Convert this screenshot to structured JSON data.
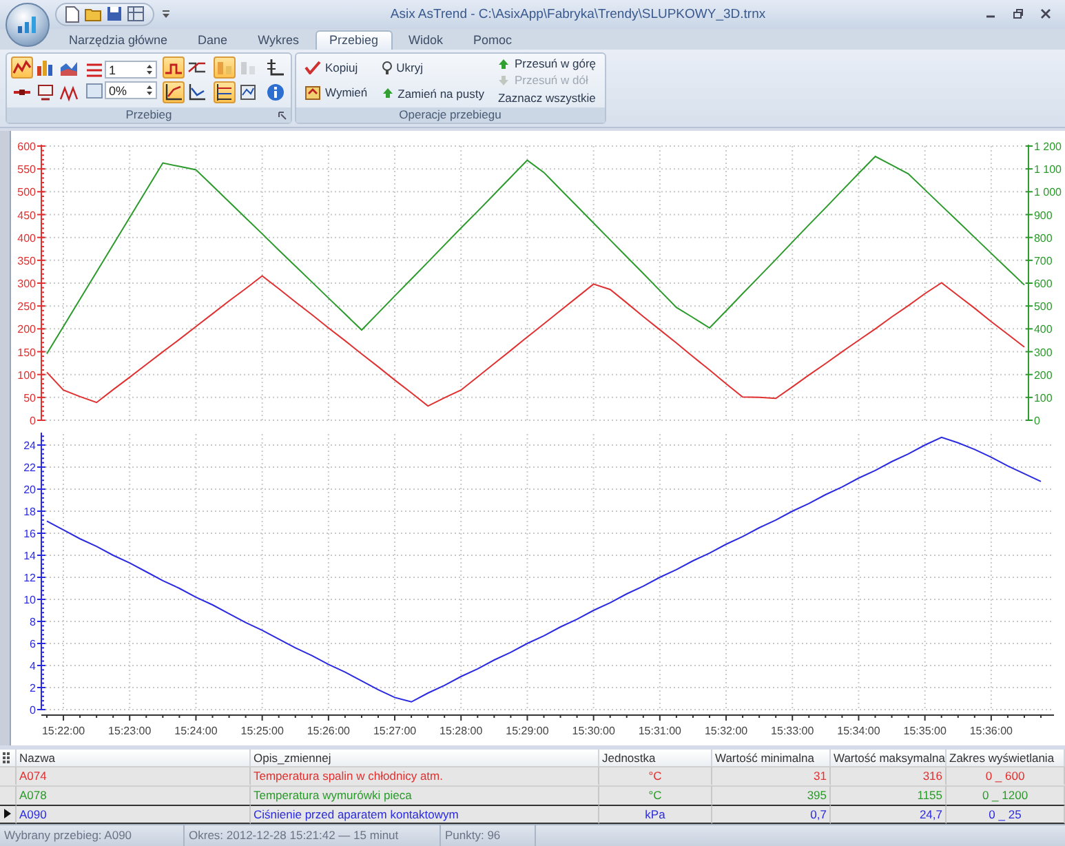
{
  "window": {
    "title": "Asix AsTrend - C:\\AsixApp\\Fabryka\\Trendy\\SLUPKOWY_3D.trnx"
  },
  "tabs": [
    {
      "label": "Narzędzia główne",
      "selected": false
    },
    {
      "label": "Dane",
      "selected": false
    },
    {
      "label": "Wykres",
      "selected": false
    },
    {
      "label": "Przebieg",
      "selected": true
    },
    {
      "label": "Widok",
      "selected": false
    },
    {
      "label": "Pomoc",
      "selected": false
    }
  ],
  "ribbon": {
    "series_group": {
      "label": "Przebieg",
      "tools": [
        {
          "selected": true,
          "disabled": false
        },
        {
          "selected": false,
          "disabled": false
        },
        {
          "selected": false,
          "disabled": false
        },
        {
          "selected": false,
          "disabled": false
        },
        {
          "selected": false,
          "disabled": false
        },
        {
          "selected": false,
          "disabled": false
        },
        {
          "selected": true,
          "disabled": false
        },
        {
          "selected": false,
          "disabled": false
        },
        {
          "selected": true,
          "disabled": false
        },
        {
          "selected": false,
          "disabled": false
        },
        {
          "selected": true,
          "disabled": false
        },
        {
          "selected": false,
          "disabled": true
        },
        {
          "selected": true,
          "disabled": false
        },
        {
          "selected": false,
          "disabled": false
        },
        {
          "selected": false,
          "disabled": false
        },
        {
          "selected": false,
          "disabled": false
        }
      ],
      "spinners": [
        {
          "value": "1"
        },
        {
          "value": "0%"
        }
      ]
    },
    "operations_group": {
      "label": "Operacje przebiegu",
      "columns": [
        {
          "actions": [
            {
              "label": "Kopiuj",
              "disabled": false
            },
            {
              "label": "Wymień",
              "disabled": false
            }
          ]
        },
        {
          "actions": [
            {
              "label": "Ukryj",
              "disabled": false
            },
            {
              "label": "Zamień na pusty",
              "disabled": false
            }
          ]
        },
        {
          "actions": [
            {
              "label": "Przesuń w górę",
              "disabled": false
            },
            {
              "label": "Przesuń w dół",
              "disabled": true
            },
            {
              "label": "Zaznacz wszystkie",
              "disabled": false
            }
          ]
        }
      ]
    }
  },
  "charts": [
    {
      "chart_data": {
        "type": "line",
        "categories": [
          null,
          null,
          null,
          null,
          null,
          null,
          null,
          null,
          null,
          null,
          null,
          null,
          null,
          null,
          null,
          null,
          null,
          null,
          null,
          null,
          null,
          null,
          null,
          null,
          null,
          null,
          null,
          null,
          null,
          null,
          null,
          null,
          null,
          null,
          null,
          null,
          null,
          null,
          null,
          null,
          null,
          null,
          null,
          null,
          null,
          null,
          null,
          null,
          null,
          null,
          null,
          null,
          null,
          null,
          null,
          null,
          null,
          null,
          null,
          null
        ],
        "grid": true,
        "ylim": [
          0,
          600
        ],
        "yticks": [
          0,
          50,
          100,
          150,
          200,
          250,
          300,
          350,
          400,
          450,
          500,
          550,
          600
        ],
        "y2lim": [
          0,
          1200
        ],
        "y2ticks": [
          0,
          100,
          200,
          300,
          400,
          500,
          600,
          700,
          800,
          900,
          {
            "value": 1000,
            "label": "1 000"
          },
          {
            "value": 1100,
            "label": "1 100"
          },
          {
            "value": 1200,
            "label": "1 200"
          }
        ],
        "series": [
          {
            "color": "#e03030",
            "values": [
              105,
              66,
              52,
              39,
              67,
              94,
              122,
              150,
              177,
              205,
              233,
              261,
              288,
              316,
              288,
              259,
              231,
              202,
              174,
              145,
              117,
              88,
              60,
              31,
              49,
              66,
              95,
              124,
              153,
              182,
              211,
              240,
              269,
              298,
              286,
              257,
              227,
              198,
              169,
              139,
              110,
              80,
              51,
              50,
              48,
              73,
              99,
              124,
              150,
              175,
              200,
              226,
              251,
              277,
              301,
              273,
              245,
              216,
              188,
              160
            ]
          },
          {
            "color": "#2a9a2a",
            "axis": "y2",
            "values": [
              291,
              410,
              529,
              649,
              768,
              887,
              1007,
              1126,
              1111,
              1096,
              1026,
              956,
              886,
              816,
              745,
              675,
              605,
              535,
              465,
              395,
              469,
              544,
              618,
              692,
              767,
              841,
              915,
              989,
              1064,
              1138,
              1084,
              1010,
              937,
              863,
              789,
              715,
              642,
              568,
              494,
              449,
              404,
              479,
              554,
              629,
              704,
              780,
              855,
              930,
              1005,
              1080,
              1155,
              1117,
              1078,
              1009,
              939,
              870,
              800,
              731,
              661,
              592
            ]
          }
        ]
      }
    },
    {
      "chart_data": {
        "type": "line",
        "categories": [
          null,
          "15:22:00",
          null,
          null,
          null,
          "15:23:00",
          null,
          null,
          null,
          "15:24:00",
          null,
          null,
          null,
          "15:25:00",
          null,
          null,
          null,
          "15:26:00",
          null,
          null,
          null,
          "15:27:00",
          null,
          null,
          null,
          "15:28:00",
          null,
          null,
          null,
          "15:29:00",
          null,
          null,
          null,
          "15:30:00",
          null,
          null,
          null,
          "15:31:00",
          null,
          null,
          null,
          "15:32:00",
          null,
          null,
          null,
          "15:33:00",
          null,
          null,
          null,
          "15:34:00",
          null,
          null,
          null,
          "15:35:00",
          null,
          null,
          null,
          "15:36:00",
          null,
          null,
          null
        ],
        "grid": true,
        "ylim": [
          0,
          25
        ],
        "yticks": [
          0,
          2,
          4,
          6,
          8,
          10,
          12,
          14,
          16,
          18,
          20,
          22,
          24
        ],
        "series": [
          {
            "color": "#2a2ae0",
            "values": [
              17.1,
              16.3,
              15.5,
              14.8,
              14.0,
              13.3,
              12.5,
              11.7,
              11.0,
              10.2,
              9.5,
              8.7,
              7.9,
              7.2,
              6.4,
              5.6,
              4.9,
              4.1,
              3.4,
              2.6,
              1.8,
              1.1,
              0.7,
              1.5,
              2.2,
              3.0,
              3.7,
              4.5,
              5.2,
              6.0,
              6.7,
              7.5,
              8.2,
              9.0,
              9.7,
              10.5,
              11.2,
              12.0,
              12.7,
              13.5,
              14.2,
              15.0,
              15.7,
              16.5,
              17.2,
              18.0,
              18.7,
              19.5,
              20.2,
              21.0,
              21.7,
              22.5,
              23.2,
              24.0,
              24.7,
              24.2,
              23.6,
              22.9,
              22.1,
              21.4,
              20.7
            ]
          }
        ]
      }
    }
  ],
  "table": {
    "columns": [
      "Nazwa",
      "Opis_zmiennej",
      "Jednostka",
      "Wartość minimalna",
      "Wartość maksymalna",
      "Zakres wyświetlania"
    ],
    "rows": [
      {
        "selected": false,
        "color": "#e03030",
        "cells": [
          "A074",
          "Temperatura spalin w chłodnicy atm.",
          "°C",
          "31",
          "316",
          "0 _ 600"
        ]
      },
      {
        "selected": false,
        "color": "#2a9a2a",
        "cells": [
          "A078",
          "Temperatura wymurówki pieca",
          "°C",
          "395",
          "1155",
          "0 _ 1200"
        ]
      },
      {
        "selected": true,
        "color": "#2a2ae0",
        "cells": [
          "A090",
          "Ciśnienie przed aparatem kontaktowym",
          "kPa",
          "0,7",
          "24,7",
          "0 _ 25"
        ]
      }
    ]
  },
  "status_bar": [
    "Wybrany przebieg: A090",
    "Okres: 2012-12-28 15:21:42 — 15 minut",
    "Punkty: 96"
  ]
}
